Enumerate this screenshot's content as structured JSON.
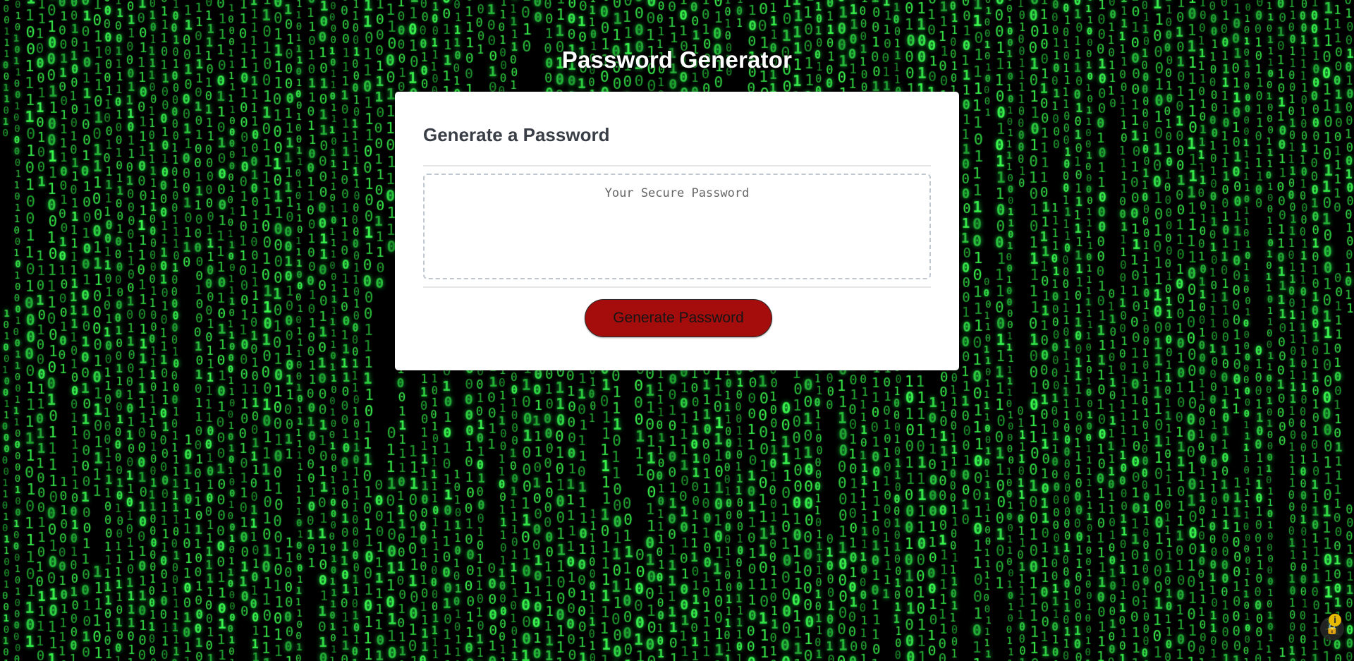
{
  "page": {
    "title": "Password Generator"
  },
  "card": {
    "title": "Generate a Password",
    "password_value": "",
    "password_placeholder": "Your Secure Password",
    "generate_label": "Generate Password"
  },
  "background": {
    "style": "matrix binary rain",
    "glyphs": [
      "0",
      "1"
    ],
    "glyph_color": "#21f04a",
    "base_color": "#000000"
  },
  "colors": {
    "button_fill": "#a50d0d",
    "title_text": "#393e46",
    "header_text": "#ffffff",
    "card_bg": "#ffffff"
  },
  "status_icons": {
    "lock": "lock-icon",
    "info": "info-icon",
    "info_glyph": "i",
    "lock_glyph": "🔒"
  }
}
